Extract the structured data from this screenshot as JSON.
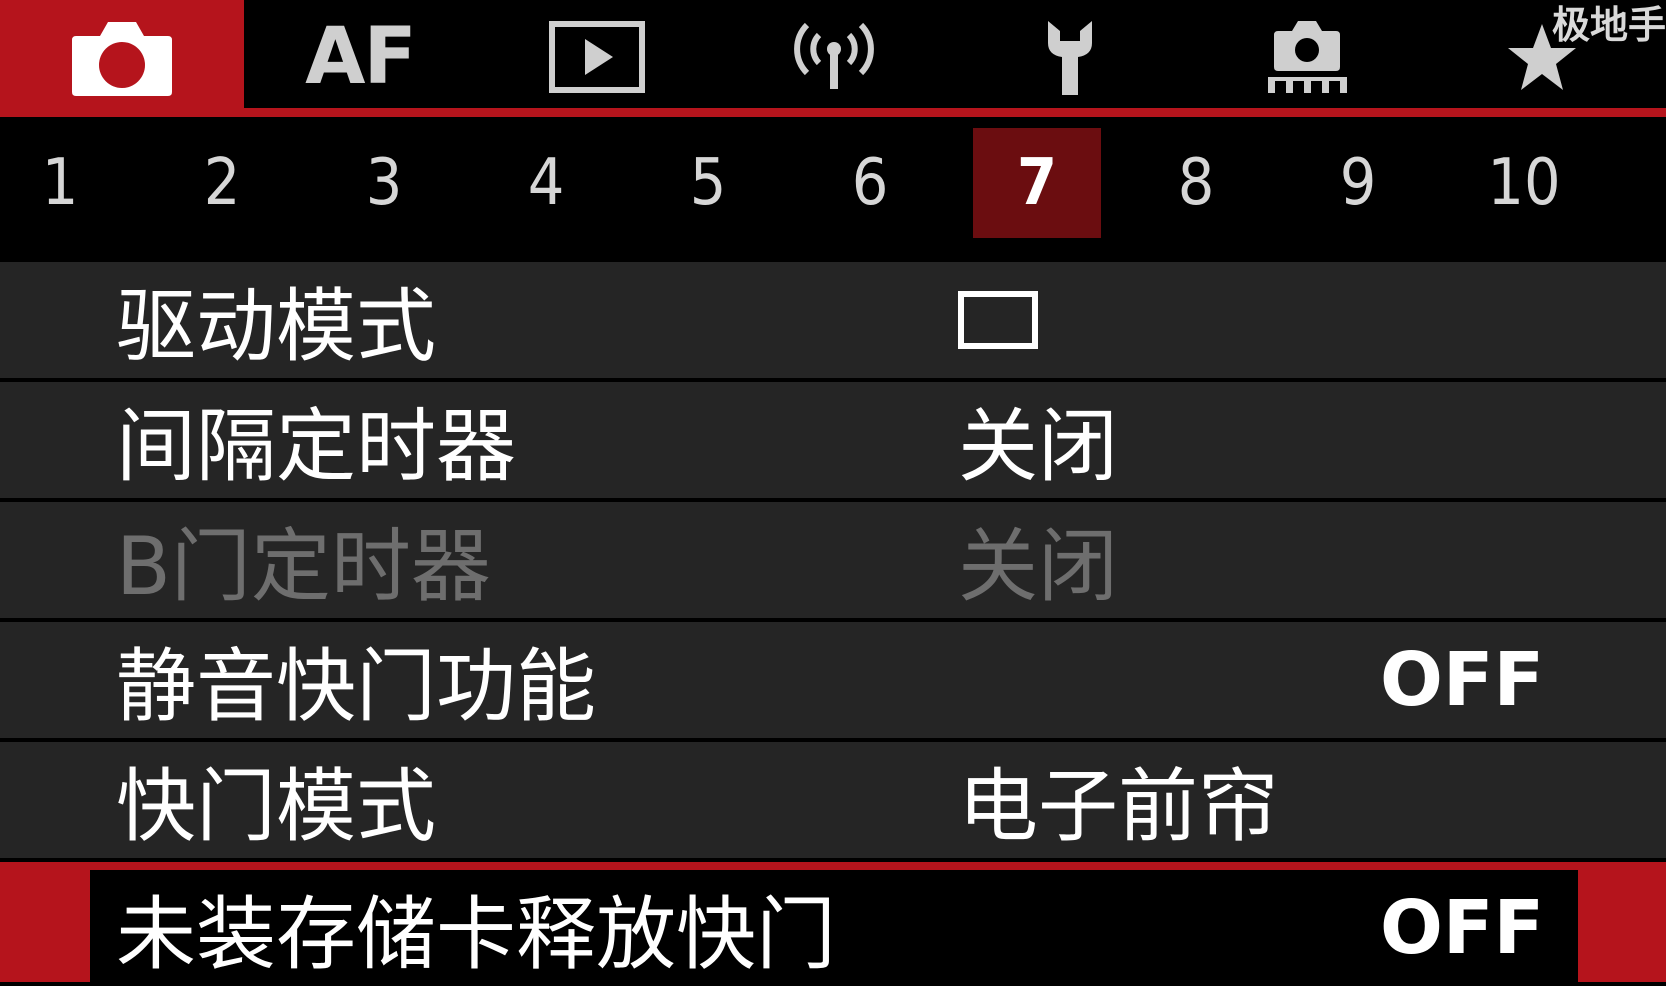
{
  "watermark": "极地手",
  "category_tabs": [
    {
      "name": "camera-icon",
      "active": true
    },
    {
      "name": "af",
      "label": "AF"
    },
    {
      "name": "playback-icon"
    },
    {
      "name": "wireless-icon"
    },
    {
      "name": "wrench-icon"
    },
    {
      "name": "custom-functions-icon"
    },
    {
      "name": "star-icon"
    }
  ],
  "colors": {
    "accent": "#b5141c",
    "active_page": "#6b0d10",
    "row_bg": "#252525",
    "disabled_text": "#6e6e6e"
  },
  "pages": [
    "1",
    "2",
    "3",
    "4",
    "5",
    "6",
    "7",
    "8",
    "9",
    "10"
  ],
  "active_page": "7",
  "menu": {
    "rows": [
      {
        "label": "驱动模式",
        "value_icon": "single-shot-icon"
      },
      {
        "label": "间隔定时器",
        "value": "关闭"
      },
      {
        "label": "B门定时器",
        "value": "关闭",
        "disabled": true
      },
      {
        "label": "静音快门功能",
        "value": "OFF"
      },
      {
        "label": "快门模式",
        "value": "电子前帘"
      },
      {
        "label": "未装存储卡释放快门",
        "value": "OFF",
        "selected": true
      }
    ]
  }
}
